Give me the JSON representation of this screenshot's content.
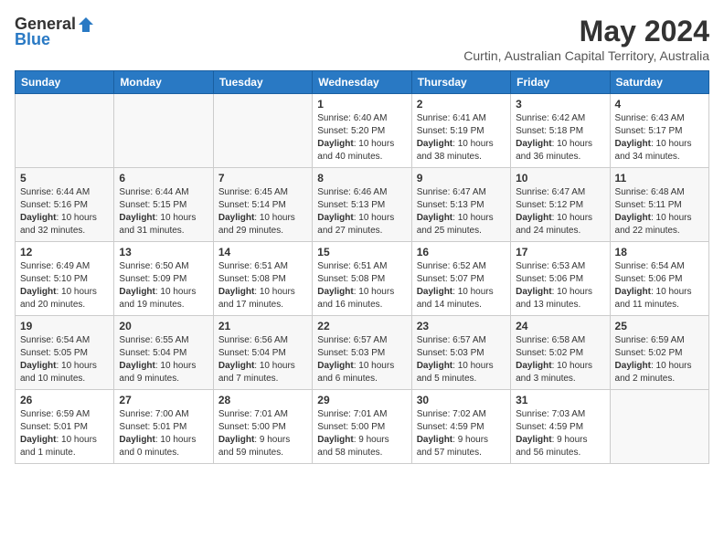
{
  "header": {
    "logo_general": "General",
    "logo_blue": "Blue",
    "month": "May 2024",
    "location": "Curtin, Australian Capital Territory, Australia"
  },
  "days_of_week": [
    "Sunday",
    "Monday",
    "Tuesday",
    "Wednesday",
    "Thursday",
    "Friday",
    "Saturday"
  ],
  "weeks": [
    {
      "days": [
        {
          "number": "",
          "info": ""
        },
        {
          "number": "",
          "info": ""
        },
        {
          "number": "",
          "info": ""
        },
        {
          "number": "1",
          "info": "Sunrise: 6:40 AM\nSunset: 5:20 PM\nDaylight: 10 hours and 40 minutes."
        },
        {
          "number": "2",
          "info": "Sunrise: 6:41 AM\nSunset: 5:19 PM\nDaylight: 10 hours and 38 minutes."
        },
        {
          "number": "3",
          "info": "Sunrise: 6:42 AM\nSunset: 5:18 PM\nDaylight: 10 hours and 36 minutes."
        },
        {
          "number": "4",
          "info": "Sunrise: 6:43 AM\nSunset: 5:17 PM\nDaylight: 10 hours and 34 minutes."
        }
      ]
    },
    {
      "days": [
        {
          "number": "5",
          "info": "Sunrise: 6:44 AM\nSunset: 5:16 PM\nDaylight: 10 hours and 32 minutes."
        },
        {
          "number": "6",
          "info": "Sunrise: 6:44 AM\nSunset: 5:15 PM\nDaylight: 10 hours and 31 minutes."
        },
        {
          "number": "7",
          "info": "Sunrise: 6:45 AM\nSunset: 5:14 PM\nDaylight: 10 hours and 29 minutes."
        },
        {
          "number": "8",
          "info": "Sunrise: 6:46 AM\nSunset: 5:13 PM\nDaylight: 10 hours and 27 minutes."
        },
        {
          "number": "9",
          "info": "Sunrise: 6:47 AM\nSunset: 5:13 PM\nDaylight: 10 hours and 25 minutes."
        },
        {
          "number": "10",
          "info": "Sunrise: 6:47 AM\nSunset: 5:12 PM\nDaylight: 10 hours and 24 minutes."
        },
        {
          "number": "11",
          "info": "Sunrise: 6:48 AM\nSunset: 5:11 PM\nDaylight: 10 hours and 22 minutes."
        }
      ]
    },
    {
      "days": [
        {
          "number": "12",
          "info": "Sunrise: 6:49 AM\nSunset: 5:10 PM\nDaylight: 10 hours and 20 minutes."
        },
        {
          "number": "13",
          "info": "Sunrise: 6:50 AM\nSunset: 5:09 PM\nDaylight: 10 hours and 19 minutes."
        },
        {
          "number": "14",
          "info": "Sunrise: 6:51 AM\nSunset: 5:08 PM\nDaylight: 10 hours and 17 minutes."
        },
        {
          "number": "15",
          "info": "Sunrise: 6:51 AM\nSunset: 5:08 PM\nDaylight: 10 hours and 16 minutes."
        },
        {
          "number": "16",
          "info": "Sunrise: 6:52 AM\nSunset: 5:07 PM\nDaylight: 10 hours and 14 minutes."
        },
        {
          "number": "17",
          "info": "Sunrise: 6:53 AM\nSunset: 5:06 PM\nDaylight: 10 hours and 13 minutes."
        },
        {
          "number": "18",
          "info": "Sunrise: 6:54 AM\nSunset: 5:06 PM\nDaylight: 10 hours and 11 minutes."
        }
      ]
    },
    {
      "days": [
        {
          "number": "19",
          "info": "Sunrise: 6:54 AM\nSunset: 5:05 PM\nDaylight: 10 hours and 10 minutes."
        },
        {
          "number": "20",
          "info": "Sunrise: 6:55 AM\nSunset: 5:04 PM\nDaylight: 10 hours and 9 minutes."
        },
        {
          "number": "21",
          "info": "Sunrise: 6:56 AM\nSunset: 5:04 PM\nDaylight: 10 hours and 7 minutes."
        },
        {
          "number": "22",
          "info": "Sunrise: 6:57 AM\nSunset: 5:03 PM\nDaylight: 10 hours and 6 minutes."
        },
        {
          "number": "23",
          "info": "Sunrise: 6:57 AM\nSunset: 5:03 PM\nDaylight: 10 hours and 5 minutes."
        },
        {
          "number": "24",
          "info": "Sunrise: 6:58 AM\nSunset: 5:02 PM\nDaylight: 10 hours and 3 minutes."
        },
        {
          "number": "25",
          "info": "Sunrise: 6:59 AM\nSunset: 5:02 PM\nDaylight: 10 hours and 2 minutes."
        }
      ]
    },
    {
      "days": [
        {
          "number": "26",
          "info": "Sunrise: 6:59 AM\nSunset: 5:01 PM\nDaylight: 10 hours and 1 minute."
        },
        {
          "number": "27",
          "info": "Sunrise: 7:00 AM\nSunset: 5:01 PM\nDaylight: 10 hours and 0 minutes."
        },
        {
          "number": "28",
          "info": "Sunrise: 7:01 AM\nSunset: 5:00 PM\nDaylight: 9 hours and 59 minutes."
        },
        {
          "number": "29",
          "info": "Sunrise: 7:01 AM\nSunset: 5:00 PM\nDaylight: 9 hours and 58 minutes."
        },
        {
          "number": "30",
          "info": "Sunrise: 7:02 AM\nSunset: 4:59 PM\nDaylight: 9 hours and 57 minutes."
        },
        {
          "number": "31",
          "info": "Sunrise: 7:03 AM\nSunset: 4:59 PM\nDaylight: 9 hours and 56 minutes."
        },
        {
          "number": "",
          "info": ""
        }
      ]
    }
  ]
}
